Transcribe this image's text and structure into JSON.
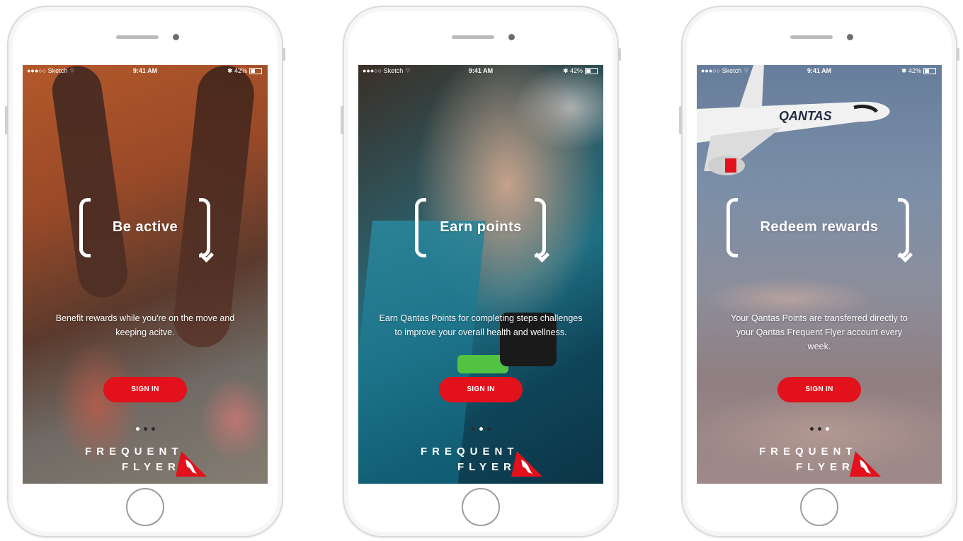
{
  "colors": {
    "accent": "#e2111b",
    "text": "#ffffff"
  },
  "phones": [
    {
      "status": {
        "carrier": "●●●○○ Sketch ⌔",
        "time": "9:41 AM",
        "battery": "✱ 42%"
      },
      "headline": "Be active",
      "body": "Benefit rewards while you're on the move and keeping acitve.",
      "button": "SIGN IN",
      "active_page": 1,
      "logo": {
        "line1": "FREQUENT",
        "line2": "FLYER"
      }
    },
    {
      "status": {
        "carrier": "●●●○○ Sketch ⌔",
        "time": "9:41 AM",
        "battery": "✱ 42%"
      },
      "headline": "Earn points",
      "body": "Earn Qantas Points for completing steps challenges to improve your overall health and wellness.",
      "button": "SIGN IN",
      "active_page": 2,
      "logo": {
        "line1": "FREQUENT",
        "line2": "FLYER"
      }
    },
    {
      "status": {
        "carrier": "●●●○○ Sketch ⌔",
        "time": "9:41 AM",
        "battery": "✱ 42%"
      },
      "headline": "Redeem rewards",
      "body": "Your Qantas Points are transferred directly to your Qantas Frequent Flyer account every week.",
      "button": "SIGN IN",
      "active_page": 3,
      "aircraft_text": "QANTAS",
      "logo": {
        "line1": "FREQUENT",
        "line2": "FLYER"
      }
    }
  ]
}
